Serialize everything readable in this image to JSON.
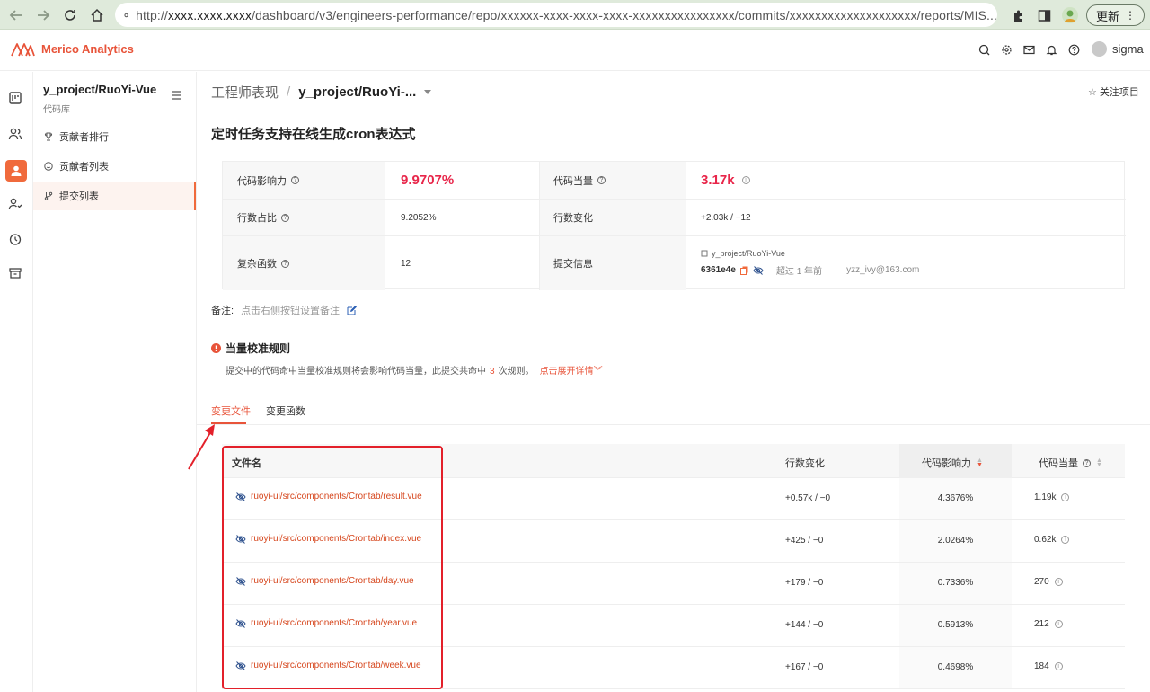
{
  "browser": {
    "url_prefix": "http://",
    "url_host": "xxxx.xxxx.xxxx",
    "url_path": "/dashboard/v3/engineers-performance/repo/xxxxxx-xxxx-xxxx-xxxx-xxxxxxxxxxxxxxxx/commits/xxxxxxxxxxxxxxxxxxxx/reports/MIS...",
    "update_label": "更新"
  },
  "app": {
    "brand": "Merico Analytics",
    "user": "sigma"
  },
  "sidebar": {
    "repo_name": "y_project/RuoYi-Vue",
    "repo_sub": "代码库",
    "items": [
      {
        "label": "贡献者排行"
      },
      {
        "label": "贡献者列表"
      },
      {
        "label": "提交列表"
      }
    ]
  },
  "breadcrumb": {
    "root": "工程师表现",
    "sep": "/",
    "current": "y_project/RuoYi-..."
  },
  "follow_label": "关注项目",
  "commit_title": "定时任务支持在线生成cron表达式",
  "info": {
    "impact_label": "代码影响力",
    "impact_value": "9.9707%",
    "equiv_label": "代码当量",
    "equiv_value": "3.17k",
    "lines_ratio_label": "行数占比",
    "lines_ratio_value": "9.2052%",
    "lines_change_label": "行数变化",
    "lines_change_value": "+2.03k / −12",
    "complex_label": "复杂函数",
    "complex_value": "12",
    "commit_info_label": "提交信息",
    "commit_repo": "y_project/RuoYi-Vue",
    "commit_hash": "6361e4e",
    "commit_time": "超过 1 年前",
    "commit_email": "yzz_ivy@163.com"
  },
  "note": {
    "label": "备注:",
    "placeholder": "点击右侧按钮设置备注"
  },
  "rules": {
    "title": "当量校准规则",
    "desc_before": "提交中的代码命中当量校准规则将会影响代码当量，此提交共命中",
    "count": "3",
    "desc_after": "次规则。",
    "link": "点击展开详情"
  },
  "tabs": [
    {
      "label": "变更文件"
    },
    {
      "label": "变更函数"
    }
  ],
  "files": {
    "headers": {
      "name": "文件名",
      "lines": "行数变化",
      "impact": "代码影响力",
      "equiv": "代码当量"
    },
    "rows": [
      {
        "name": "ruoyi-ui/src/components/Crontab/result.vue",
        "lines": "+0.57k / −0",
        "impact": "4.3676%",
        "equiv": "1.19k"
      },
      {
        "name": "ruoyi-ui/src/components/Crontab/index.vue",
        "lines": "+425 / −0",
        "impact": "2.0264%",
        "equiv": "0.62k"
      },
      {
        "name": "ruoyi-ui/src/components/Crontab/day.vue",
        "lines": "+179 / −0",
        "impact": "0.7336%",
        "equiv": "270"
      },
      {
        "name": "ruoyi-ui/src/components/Crontab/year.vue",
        "lines": "+144 / −0",
        "impact": "0.5913%",
        "equiv": "212"
      },
      {
        "name": "ruoyi-ui/src/components/Crontab/week.vue",
        "lines": "+167 / −0",
        "impact": "0.4698%",
        "equiv": "184"
      }
    ]
  },
  "colors": {
    "accent": "#e8543a",
    "impact_red": "#e8264a",
    "annotation_red": "#e3202a"
  }
}
